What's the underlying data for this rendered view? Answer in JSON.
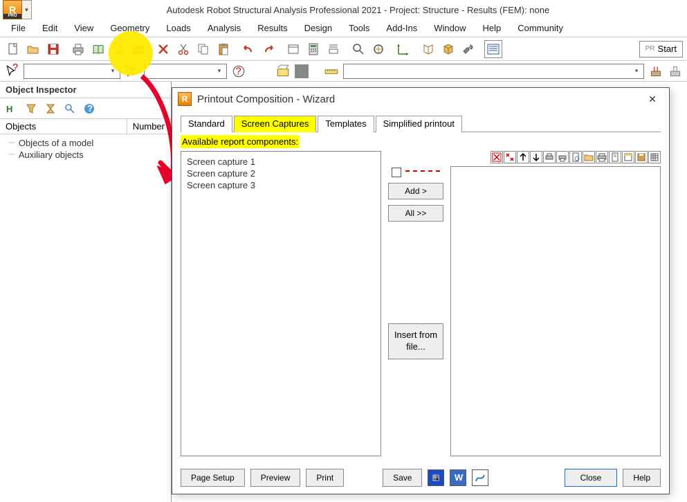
{
  "title": "Autodesk Robot Structural Analysis Professional 2021 - Project: Structure - Results (FEM): none",
  "menu": [
    "File",
    "Edit",
    "View",
    "Geometry",
    "Loads",
    "Analysis",
    "Results",
    "Design",
    "Tools",
    "Add-Ins",
    "Window",
    "Help",
    "Community"
  ],
  "start_label": "Start",
  "inspector": {
    "title": "Object Inspector",
    "col1": "Objects",
    "col2": "Number",
    "items": [
      "Objects of a model",
      "Auxiliary objects"
    ]
  },
  "dialog": {
    "title": "Printout Composition - Wizard",
    "tabs": [
      "Standard",
      "Screen Captures",
      "Templates",
      "Simplified printout"
    ],
    "active_tab": 1,
    "available_label": "Available report components:",
    "components": [
      "Screen capture 1",
      "Screen capture 2",
      "Screen capture 3"
    ],
    "add_label": "Add >",
    "all_label": "All >>",
    "insert_label_l1": "Insert from",
    "insert_label_l2": "file...",
    "footer": {
      "page_setup": "Page Setup",
      "preview": "Preview",
      "print": "Print",
      "save": "Save",
      "close": "Close",
      "help": "Help"
    }
  }
}
